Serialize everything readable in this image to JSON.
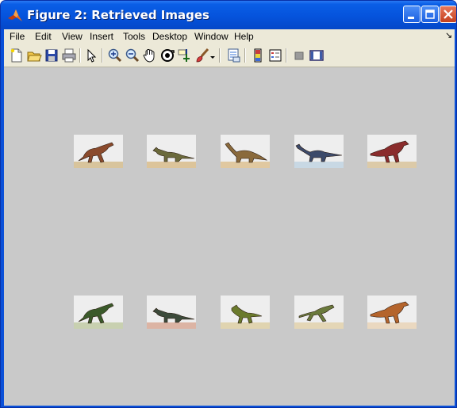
{
  "window": {
    "title": "Figure 2: Retrieved Images",
    "controls": {
      "minimize": "minimize-icon",
      "maximize": "maximize-icon",
      "close": "close-icon"
    }
  },
  "menubar": {
    "items": [
      {
        "label": "File"
      },
      {
        "label": "Edit"
      },
      {
        "label": "View"
      },
      {
        "label": "Insert"
      },
      {
        "label": "Tools"
      },
      {
        "label": "Desktop"
      },
      {
        "label": "Window"
      },
      {
        "label": "Help"
      }
    ]
  },
  "toolbar": {
    "tools": [
      "new-figure-icon",
      "open-file-icon",
      "save-icon",
      "print-icon",
      "select-arrow-icon",
      "zoom-in-icon",
      "zoom-out-icon",
      "pan-icon",
      "rotate-3d-icon",
      "data-cursor-icon",
      "brush-icon",
      "link-icon",
      "colorbar-icon",
      "legend-icon",
      "hide-plot-tools-icon",
      "show-plot-tools-icon"
    ]
  },
  "colors": {
    "title_bar": "#0553dc",
    "menu_bg": "#ece9d8",
    "figure_bg": "#c9c9c9"
  },
  "images": {
    "count": 10,
    "rows": [
      [
        {
          "name": "dinosaur-image-1",
          "body": "#8a4a2c",
          "ground": "#d8c49c",
          "pose": "raptor"
        },
        {
          "name": "dinosaur-image-2",
          "body": "#6b6a3c",
          "ground": "#dcc49a",
          "pose": "iguanodon"
        },
        {
          "name": "dinosaur-image-3",
          "body": "#8a6a3c",
          "ground": "#e0c8a0",
          "pose": "sauropod"
        },
        {
          "name": "dinosaur-image-4",
          "body": "#3c4a6a",
          "ground": "#c8d8e4",
          "pose": "longneck"
        },
        {
          "name": "dinosaur-image-5",
          "body": "#8a2c2c",
          "ground": "#dccaa8",
          "pose": "theropod"
        }
      ],
      [
        {
          "name": "dinosaur-image-6",
          "body": "#3a5a2a",
          "ground": "#c8d0b0",
          "pose": "raptor"
        },
        {
          "name": "dinosaur-image-7",
          "body": "#3c4a3a",
          "ground": "#dcb4a4",
          "pose": "iguanodon"
        },
        {
          "name": "dinosaur-image-8",
          "body": "#6a7a2c",
          "ground": "#e0d4b0",
          "pose": "small"
        },
        {
          "name": "dinosaur-image-9",
          "body": "#6a7a3c",
          "ground": "#e4d6b6",
          "pose": "runner"
        },
        {
          "name": "dinosaur-image-10",
          "body": "#b4642c",
          "ground": "#ead8c0",
          "pose": "theropod"
        }
      ]
    ]
  }
}
